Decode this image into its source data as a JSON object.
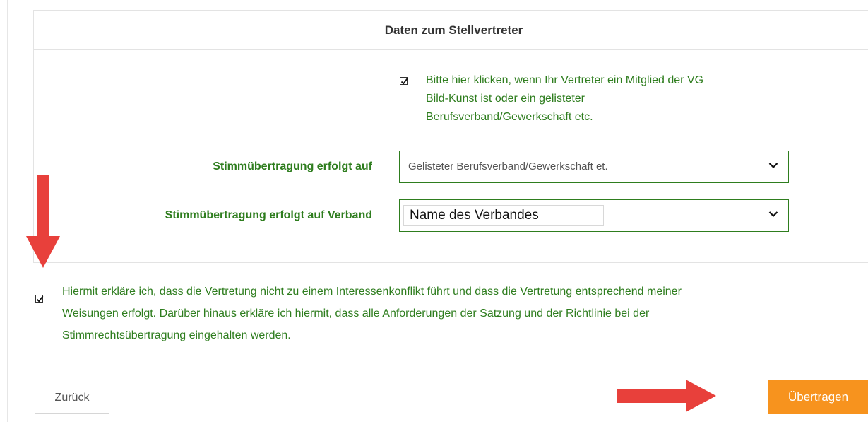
{
  "panel": {
    "title": "Daten zum Stellvertreter"
  },
  "representative_checkbox": {
    "checked": true,
    "label": "Bitte hier klicken, wenn Ihr Vertreter ein Mitglied der VG Bild-Kunst ist oder ein gelisteter Berufsverband/Gewerkschaft etc.",
    "line1": "Bitte hier klicken, wenn Ihr Vertreter ein Mitglied der VG",
    "line2": "Bild-Kunst ist oder ein gelisteter",
    "line3": "Berufsverband/Gewerkschaft etc."
  },
  "vote_transfer": {
    "label": "Stimmübertragung erfolgt auf",
    "selected": "Gelisteter Berufsverband/Gewerkschaft et."
  },
  "vote_transfer_association": {
    "label": "Stimmübertragung erfolgt auf Verband",
    "selected": "Name des Verbandes"
  },
  "declaration_checkbox": {
    "checked": true,
    "line1": "Hiermit erkläre ich, dass die Vertretung nicht zu einem Interessenkonflikt führt und dass die Vertretung entsprechend meiner",
    "line2": "Weisungen erfolgt. Darüber hinaus erkläre ich hiermit, dass alle Anforderungen der Satzung und der Richtlinie bei der",
    "line3": "Stimmrechtsübertragung eingehalten werden."
  },
  "buttons": {
    "back": "Zurück",
    "submit": "Übertragen"
  },
  "colors": {
    "accent_green": "#2e7d1e",
    "submit_orange": "#f7931e",
    "annotation_red": "#e8403b"
  },
  "icons": {
    "checkbox": "checkmark-icon",
    "dropdown": "chevron-down-icon",
    "annotation_down": "red-arrow-down-icon",
    "annotation_right": "red-arrow-right-icon"
  }
}
